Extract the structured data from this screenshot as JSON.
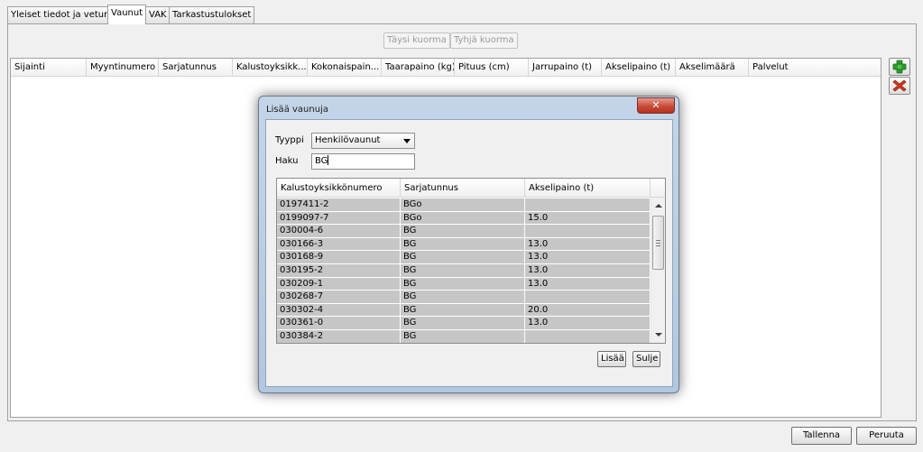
{
  "tabs": [
    {
      "label": "Yleiset tiedot ja veturit"
    },
    {
      "label": "Vaunut"
    },
    {
      "label": "VAK"
    },
    {
      "label": "Tarkastustulokset"
    }
  ],
  "toolbar": {
    "full_load_label": "Täysi kuorma",
    "empty_load_label": "Tyhjä kuorma"
  },
  "main_table": {
    "columns": [
      "Sijainti",
      "Myyntinumero",
      "Sarjatunnus",
      "Kalustoyksikk...",
      "Kokonaispain...",
      "Taarapaino (kg)",
      "Pituus (cm)",
      "Jarrupaino (t)",
      "Akselipaino (t)",
      "Akselimäärä",
      "Palvelut"
    ]
  },
  "side_buttons": {
    "add_icon": "plus-icon",
    "remove_icon": "delete-icon",
    "add_color": "#2e9a2e",
    "remove_color": "#d23b1f"
  },
  "dialog": {
    "title": "Lisää vaunuja",
    "type_label": "Tyyppi",
    "type_value": "Henkilövaunut",
    "search_label": "Haku",
    "search_value": "BG",
    "columns": [
      "Kalustoyksikkönumero",
      "Sarjatunnus",
      "Akselipaino (t)"
    ],
    "rows": [
      {
        "id": "0197411-2",
        "series": "BGo",
        "axle": ""
      },
      {
        "id": "0199097-7",
        "series": "BGo",
        "axle": "15.0"
      },
      {
        "id": "030004-6",
        "series": "BG",
        "axle": ""
      },
      {
        "id": "030166-3",
        "series": "BG",
        "axle": "13.0"
      },
      {
        "id": "030168-9",
        "series": "BG",
        "axle": "13.0"
      },
      {
        "id": "030195-2",
        "series": "BG",
        "axle": "13.0"
      },
      {
        "id": "030209-1",
        "series": "BG",
        "axle": "13.0"
      },
      {
        "id": "030268-7",
        "series": "BG",
        "axle": ""
      },
      {
        "id": "030302-4",
        "series": "BG",
        "axle": "20.0"
      },
      {
        "id": "030361-0",
        "series": "BG",
        "axle": "13.0"
      },
      {
        "id": "030384-2",
        "series": "BG",
        "axle": ""
      }
    ],
    "add_label": "Lisää",
    "close_label": "Sulje",
    "close_glyph": "✕"
  },
  "footer": {
    "save_label": "Tallenna",
    "cancel_label": "Peruuta"
  }
}
